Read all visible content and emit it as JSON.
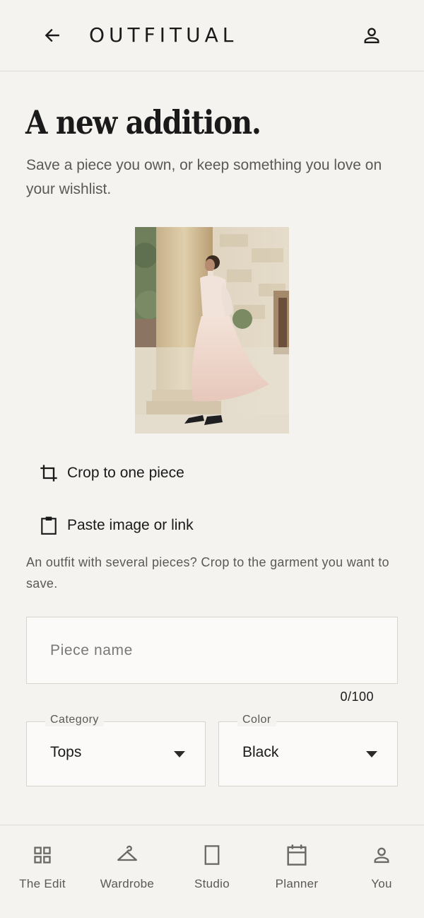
{
  "header": {
    "brand": "OUTFITUAL",
    "back_icon": "arrow-left-icon",
    "account_icon": "person-icon"
  },
  "main": {
    "title": "A new addition.",
    "subtitle": "Save a piece you own, or keep something you love on your wishlist.",
    "photo_alt": "Woman in a long blush dress standing beside a stone column",
    "actions": [
      {
        "label": "Crop to one piece",
        "icon": "crop-icon"
      },
      {
        "label": "Paste image or link",
        "icon": "clipboard-icon"
      }
    ],
    "hint": "An outfit with several pieces? Crop to the garment you want to save.",
    "name_field": {
      "placeholder": "Piece name",
      "value": "",
      "counter": "0/100"
    },
    "category": {
      "label": "Category",
      "value": "Tops"
    },
    "color": {
      "label": "Color",
      "value": "Black"
    }
  },
  "nav": {
    "items": [
      {
        "label": "The Edit",
        "icon": "grid-icon"
      },
      {
        "label": "Wardrobe",
        "icon": "hanger-icon"
      },
      {
        "label": "Studio",
        "icon": "frame-icon"
      },
      {
        "label": "Planner",
        "icon": "calendar-icon"
      },
      {
        "label": "You",
        "icon": "person-icon"
      }
    ]
  },
  "colors": {
    "background": "#f5f3ef",
    "text": "#1a1a1a",
    "muted": "#5b5955",
    "border": "#dcdad5",
    "field_bg": "#fbfaf8"
  }
}
